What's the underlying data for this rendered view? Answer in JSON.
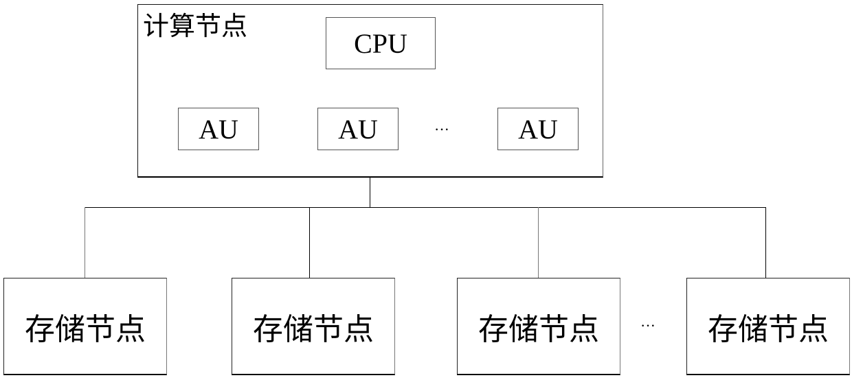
{
  "compute_node": {
    "title": "计算节点",
    "cpu_label": "CPU",
    "au_units": [
      {
        "label": "AU"
      },
      {
        "label": "AU"
      },
      {
        "label": "AU"
      }
    ],
    "ellipsis": "···"
  },
  "storage_nodes": [
    {
      "label": "存储节点"
    },
    {
      "label": "存储节点"
    },
    {
      "label": "存储节点"
    },
    {
      "label": "存储节点"
    }
  ],
  "storage_ellipsis": "···"
}
